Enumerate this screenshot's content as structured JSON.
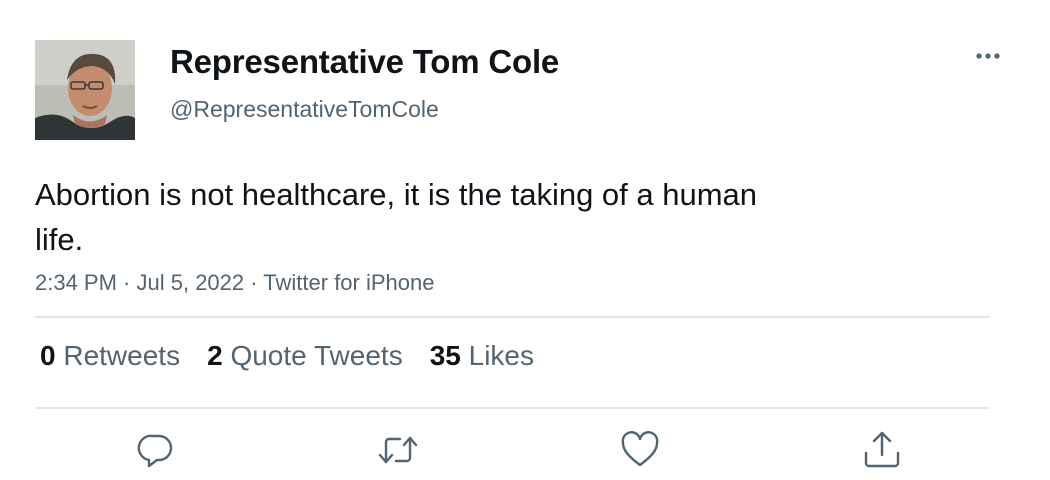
{
  "author": {
    "display_name": "Representative Tom Cole",
    "handle": "@RepresentativeTomCole",
    "avatar_icon": "profile-photo"
  },
  "tweet": {
    "text": "Abortion is not healthcare, it is the taking of a human life.",
    "time": "2:34 PM",
    "sep1": " · ",
    "date": "Jul 5, 2022",
    "sep2": " · ",
    "source": "Twitter for iPhone"
  },
  "stats": {
    "retweets": {
      "count": "0",
      "label": "Retweets"
    },
    "quotes": {
      "count": "2",
      "label": "Quote Tweets"
    },
    "likes": {
      "count": "35",
      "label": "Likes"
    }
  },
  "actions": [
    {
      "name": "reply",
      "icon": "reply-icon"
    },
    {
      "name": "retweet",
      "icon": "retweet-icon"
    },
    {
      "name": "like",
      "icon": "heart-icon"
    },
    {
      "name": "share",
      "icon": "share-icon"
    }
  ],
  "colors": {
    "text_primary": "#0f1419",
    "text_secondary": "#536471",
    "divider": "#e3e7ea",
    "icon": "#536471"
  }
}
